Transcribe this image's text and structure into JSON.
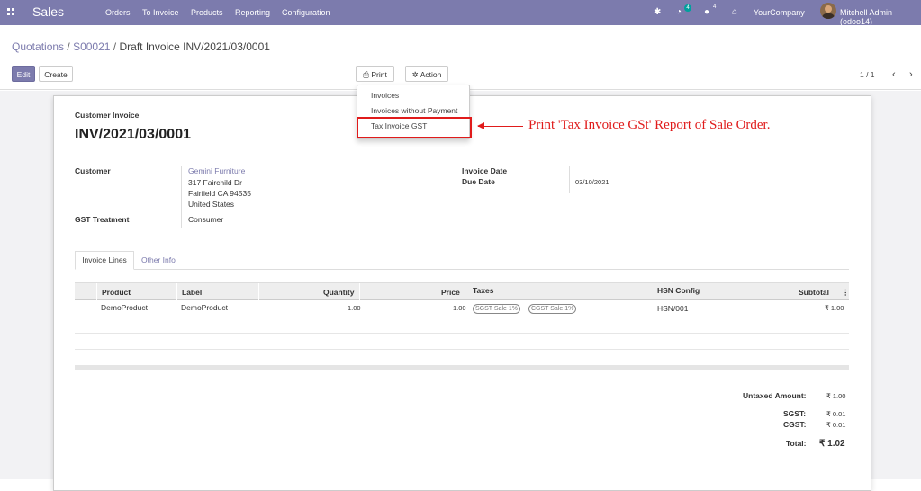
{
  "navbar": {
    "app_name": "Sales",
    "menu": [
      "Orders",
      "To Invoice",
      "Products",
      "Reporting",
      "Configuration"
    ],
    "activity_badge": "4",
    "messages_badge": "4",
    "company": "YourCompany",
    "user": "Mitchell Admin (odoo14)",
    "accent_color": "#7c7bad"
  },
  "breadcrumb": {
    "items": [
      "Quotations",
      "S00021"
    ],
    "separator": "/",
    "current": "Draft Invoice INV/2021/03/0001"
  },
  "buttons": {
    "edit": "Edit",
    "create": "Create",
    "print": "Print",
    "action": "Action"
  },
  "pager": {
    "value": "1 / 1"
  },
  "print_menu": {
    "items": [
      "Invoices",
      "Invoices without Payment",
      "Tax Invoice GST"
    ]
  },
  "annotation": {
    "text": "Print 'Tax Invoice GSt' Report of Sale Order.",
    "color": "#e01b1b"
  },
  "invoice": {
    "type_label": "Customer Invoice",
    "number": "INV/2021/03/0001",
    "customer_label": "Customer",
    "customer_name": "Gemini Furniture",
    "address_lines": [
      "317 Fairchild Dr",
      "Fairfield CA 94535",
      "United States"
    ],
    "gst_label": "GST Treatment",
    "gst_value": "Consumer",
    "invoice_date_label": "Invoice Date",
    "invoice_date_value": "",
    "due_date_label": "Due Date",
    "due_date_value": "03/10/2021"
  },
  "tabs": {
    "active": "Invoice Lines",
    "other": "Other Info"
  },
  "table": {
    "columns": [
      "Product",
      "Label",
      "Quantity",
      "Price",
      "Taxes",
      "HSN Config",
      "Subtotal"
    ],
    "rows": [
      {
        "product": "DemoProduct",
        "label": "DemoProduct",
        "quantity": "1.00",
        "price": "1.00",
        "taxes": [
          "SGST Sale 1%",
          "CGST Sale 1%"
        ],
        "hsn": "HSN/001",
        "subtotal": "₹ 1.00"
      }
    ]
  },
  "totals": {
    "untaxed_label": "Untaxed Amount:",
    "untaxed_value": "₹ 1.00",
    "sgst_label": "SGST:",
    "sgst_value": "₹ 0.01",
    "cgst_label": "CGST:",
    "cgst_value": "₹ 0.01",
    "total_label": "Total:",
    "total_value": "₹ 1.02"
  }
}
